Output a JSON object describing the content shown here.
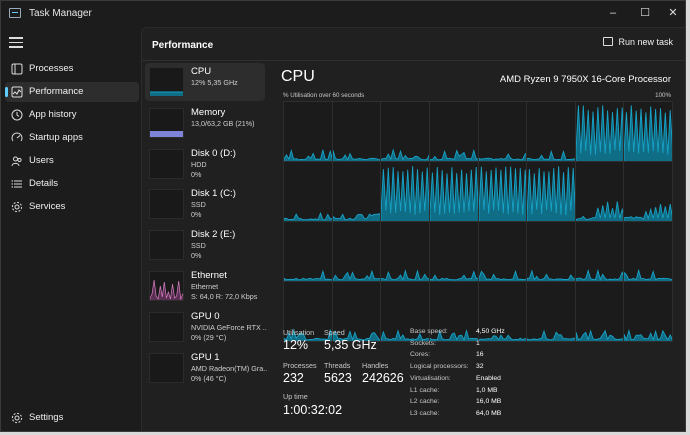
{
  "window": {
    "title": "Task Manager",
    "controls": [
      "–",
      "☐",
      "✕"
    ]
  },
  "nav": {
    "items": [
      {
        "label": "Processes",
        "icon": "processes-icon"
      },
      {
        "label": "Performance",
        "icon": "performance-icon",
        "active": true
      },
      {
        "label": "App history",
        "icon": "app-history-icon"
      },
      {
        "label": "Startup apps",
        "icon": "startup-apps-icon"
      },
      {
        "label": "Users",
        "icon": "users-icon"
      },
      {
        "label": "Details",
        "icon": "details-icon"
      },
      {
        "label": "Services",
        "icon": "services-icon"
      }
    ],
    "settings": {
      "label": "Settings",
      "icon": "settings-icon"
    }
  },
  "header": {
    "title": "Performance",
    "run_new_task": "Run new task"
  },
  "devices": [
    {
      "name": "CPU",
      "lines": [
        "12%  5,35 GHz"
      ],
      "kind": "cpu",
      "active": true
    },
    {
      "name": "Memory",
      "lines": [
        "13,0/63,2 GB (21%)"
      ],
      "kind": "memory"
    },
    {
      "name": "Disk 0 (D:)",
      "lines": [
        "HDD",
        "0%"
      ],
      "kind": "disk"
    },
    {
      "name": "Disk 1 (C:)",
      "lines": [
        "SSD",
        "0%"
      ],
      "kind": "disk"
    },
    {
      "name": "Disk 2 (E:)",
      "lines": [
        "SSD",
        "0%"
      ],
      "kind": "disk"
    },
    {
      "name": "Ethernet",
      "lines": [
        "Ethernet",
        "S: 64,0  R: 72,0 Kbps"
      ],
      "kind": "ethernet"
    },
    {
      "name": "GPU 0",
      "lines": [
        "NVIDIA GeForce RTX ...",
        "0%  (29 °C)"
      ],
      "kind": "gpu"
    },
    {
      "name": "GPU 1",
      "lines": [
        "AMD Radeon(TM) Gra...",
        "0%  (46 °C)"
      ],
      "kind": "gpu"
    }
  ],
  "detail": {
    "title": "CPU",
    "model": "AMD Ryzen 9 7950X 16-Core Processor",
    "graph_caption": "% Utilisation over 60 seconds",
    "graph_max": "100%",
    "stats": {
      "utilisation_label": "Utilisation",
      "utilisation": "12%",
      "speed_label": "Speed",
      "speed": "5,35 GHz",
      "processes_label": "Processes",
      "processes": "232",
      "threads_label": "Threads",
      "threads": "5623",
      "handles_label": "Handles",
      "handles": "242626",
      "uptime_label": "Up time",
      "uptime": "1:00:32:02"
    },
    "specs": [
      {
        "label": "Base speed:",
        "value": "4,50 GHz"
      },
      {
        "label": "Sockets:",
        "value": "1"
      },
      {
        "label": "Cores:",
        "value": "16"
      },
      {
        "label": "Logical processors:",
        "value": "32"
      },
      {
        "label": "Virtualisation:",
        "value": "Enabled"
      },
      {
        "label": "L1 cache:",
        "value": "1,0 MB"
      },
      {
        "label": "L2 cache:",
        "value": "16,0 MB"
      },
      {
        "label": "L3 cache:",
        "value": "64,0 MB"
      }
    ]
  },
  "colors": {
    "accent": "#60cdff",
    "cpu_line": "#17a2c6",
    "cpu_fill": "#0f6d86",
    "memory": "#7e85d8",
    "ethernet": "#d77fc4",
    "background": "#202020"
  }
}
